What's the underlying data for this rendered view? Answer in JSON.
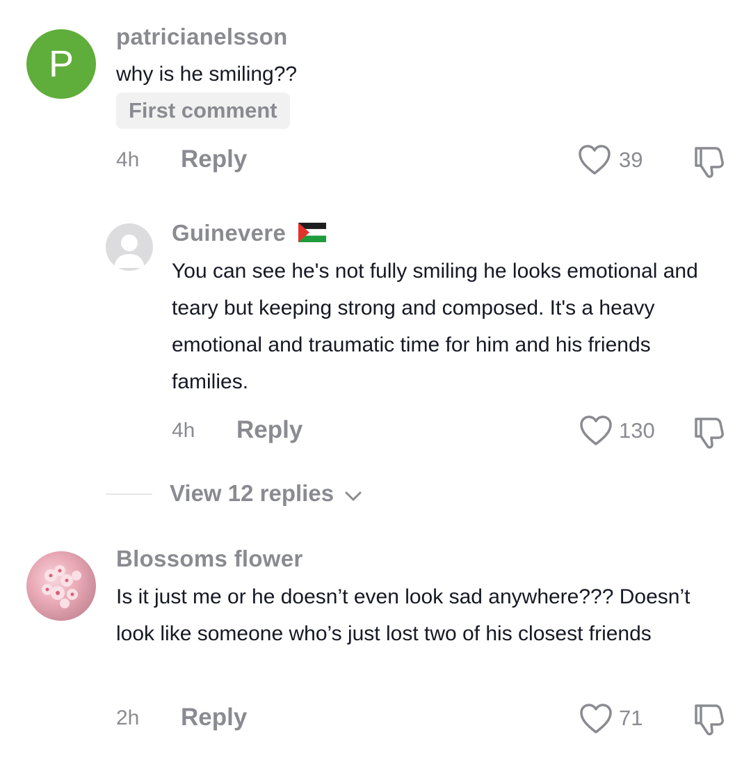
{
  "comments": [
    {
      "username": "patricianelsson",
      "avatar_letter": "P",
      "avatar_color": "#5fad3a",
      "text": "why is he smiling??",
      "badge": "First comment",
      "time": "4h",
      "reply_label": "Reply",
      "likes": "39"
    },
    {
      "username": "Guinevere",
      "flag_icon": "palestine-flag-icon",
      "text": "You can see he's not fully smiling he looks emotional and teary but keeping strong and composed. It's a heavy emotional and traumatic time for him and his friends families.",
      "time": "4h",
      "reply_label": "Reply",
      "likes": "130"
    },
    {
      "view_replies_label": "View 12 replies"
    },
    {
      "username": "Blossoms flower",
      "text": "Is it just me or he doesn’t even look sad anywhere??? Doesn’t look like someone who’s just lost two of his closest friends",
      "time": "2h",
      "reply_label": "Reply",
      "likes": "71"
    }
  ],
  "icons": {
    "like": "heart-outline-icon",
    "dislike": "thumbs-down-outline-icon",
    "expand": "chevron-down-icon"
  },
  "colors": {
    "muted": "#8a8b91",
    "text": "#161823",
    "badge_bg": "#f1f1f2"
  }
}
